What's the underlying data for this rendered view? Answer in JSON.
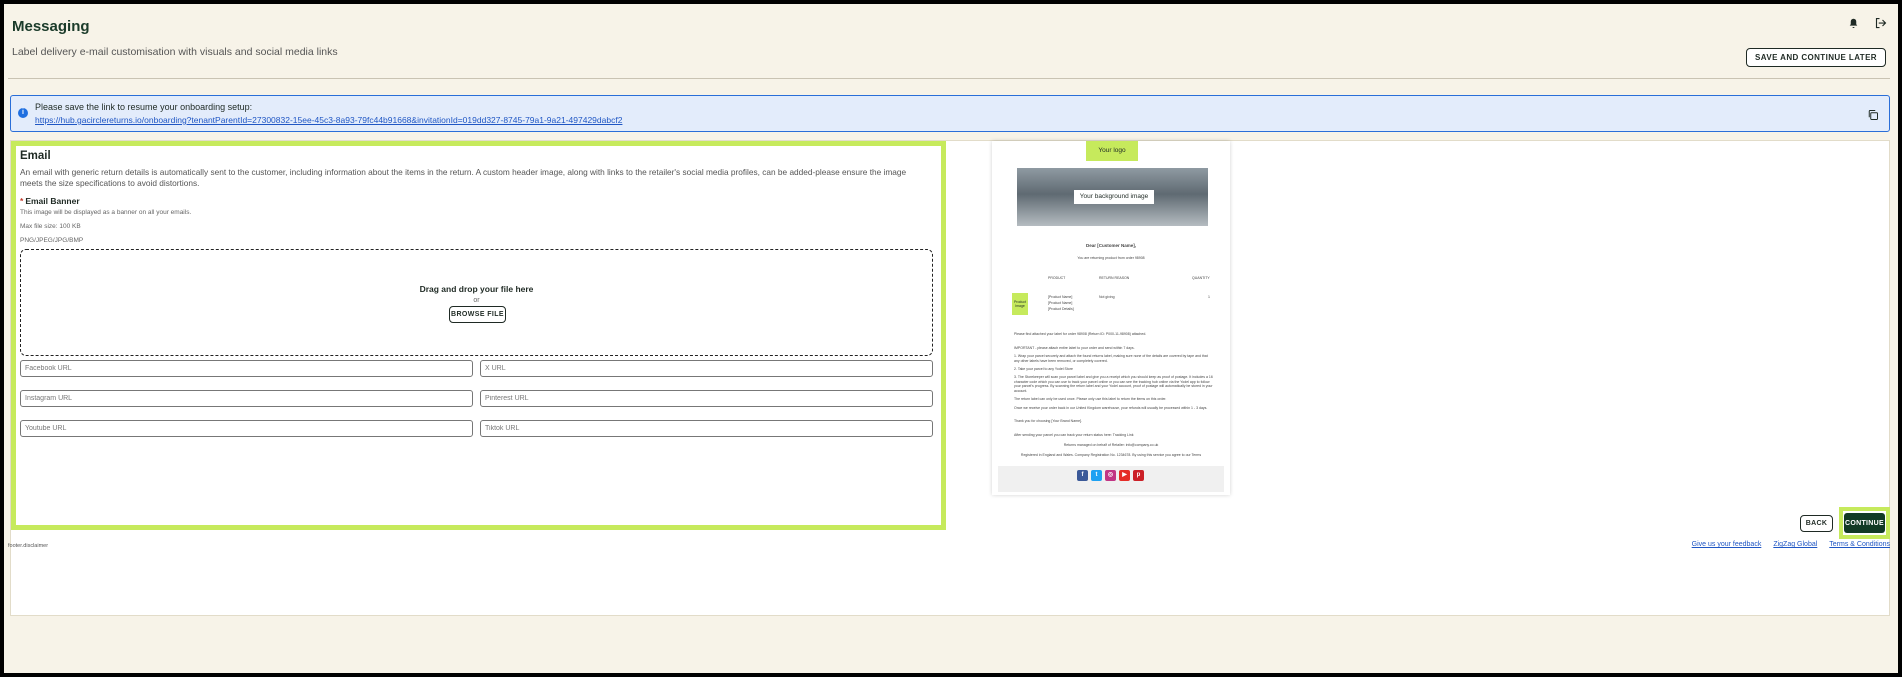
{
  "header": {
    "title": "Messaging",
    "subtitle": "Label delivery e-mail customisation with visuals and social media links",
    "save_later_label": "SAVE AND CONTINUE LATER",
    "icons": [
      "bell-icon",
      "logout-icon"
    ]
  },
  "info_banner": {
    "text": "Please save the link to resume your onboarding setup:",
    "link": "https://hub.gacirclereturns.io/onboarding?tenantParentId=27300832-15ee-45c3-8a93-79fc44b91668&invitationId=019dd327-8745-79a1-9a21-497429dabcf2"
  },
  "email": {
    "title": "Email",
    "description": "An email with generic return details is automatically sent to the customer, including information about the items in the return. A custom header image, along with links to the retailer's social media profiles, can be added-please ensure the image meets the size specifications to avoid distortions.",
    "banner_label": "Email Banner",
    "banner_required_mark": "*",
    "banner_help": "This image will be displayed as a banner on all your emails.",
    "max_size": "Max file size: 100 KB",
    "formats": "PNG/JPEG/JPG/BMP",
    "dropzone": {
      "title": "Drag and drop your file here",
      "or": "or",
      "browse_label": "BROWSE FILE"
    },
    "social_inputs": {
      "facebook": {
        "placeholder": "Facebook URL",
        "value": ""
      },
      "x": {
        "placeholder": "X URL",
        "value": ""
      },
      "instagram": {
        "placeholder": "Instagram URL",
        "value": ""
      },
      "pinterest": {
        "placeholder": "Pinterest URL",
        "value": ""
      },
      "youtube": {
        "placeholder": "Youtube URL",
        "value": ""
      },
      "tiktok": {
        "placeholder": "Tiktok URL",
        "value": ""
      }
    }
  },
  "preview": {
    "logo_text": "Your logo",
    "background_text": "Your background image",
    "greeting": "Dear [Customer Name],",
    "returning_line": "You are returning product from order 98908",
    "columns": [
      "PRODUCT",
      "RETURN REASON",
      "QUANTITY"
    ],
    "product_thumb": "Product Image",
    "product_lines": [
      "[Product Name]",
      "[Product Name]",
      "[Product Details]"
    ],
    "reason": "Not giving",
    "quantity": "1",
    "body_lines": [
      "Please find attached your label for order 98908 (Return ID: P000-11-98908) attached.",
      "IMPORTANT - please attach entire label to your order and send within 7 days.",
      "1. Wrap your parcel securely and attach the found returns label, making sure none of the details are covered by tape and that any other labels have been removed, or completely covered.",
      "2. Take your parcel to any Yodel Store",
      "3. The Storekeeper will scan your parcel label and give you a receipt which you should keep as proof of postage. It includes a 16 character code which you can use to track your parcel online or you can see the tracking hub online via the Yodel app to follow your parcel's progress. By scanning the return label and your Yodel account, proof of postage will automatically be stored in your account.",
      "The return label can only be used once. Please only use this label to return the items on this order.",
      "Once we receive your order back in our United Kingdom warehouse, your refunds will usually be processed within 1 - 3 days.",
      "Thank you for choosing [Your Brand Name].",
      "After sending your parcel you can track your return status here: Tracking Link",
      "Returns managed on behalf of Retailer: info@company.co.uk",
      "Registered in England and Wales. Company Registration No. 1234678. By using this service you agree to our Terms"
    ],
    "social_icons": [
      {
        "name": "facebook-icon",
        "glyph": "f",
        "color": "#3b5998"
      },
      {
        "name": "twitter-icon",
        "glyph": "t",
        "color": "#1da1f2"
      },
      {
        "name": "instagram-icon",
        "glyph": "◎",
        "color": "#c13584"
      },
      {
        "name": "youtube-icon",
        "glyph": "▶",
        "color": "#e52d27"
      },
      {
        "name": "pinterest-icon",
        "glyph": "p",
        "color": "#cb2027"
      }
    ]
  },
  "actions": {
    "back_label": "BACK",
    "continue_label": "CONTINUE"
  },
  "footer": {
    "disclaimer": "footer.disclaimer",
    "links": [
      "Give us your feedback",
      "ZigZag Global",
      "Terms & Conditions"
    ]
  },
  "colors": {
    "accent": "#c6ea5c",
    "primary_dark": "#123a25",
    "link": "#1f56c4",
    "info_border": "#2a6ed8"
  }
}
